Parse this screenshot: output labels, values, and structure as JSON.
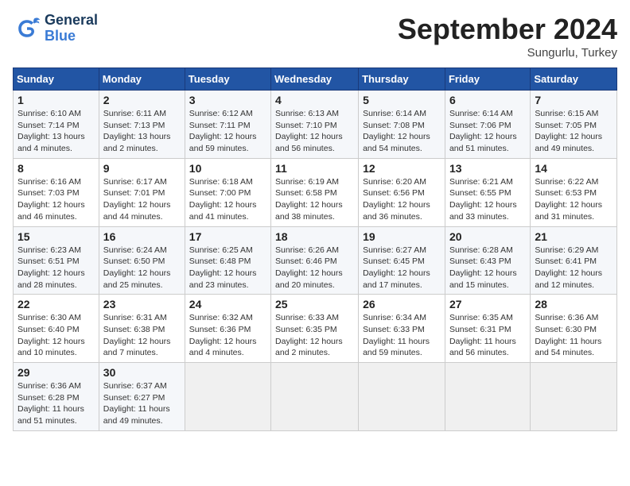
{
  "header": {
    "logo_general": "General",
    "logo_blue": "Blue",
    "month_title": "September 2024",
    "subtitle": "Sungurlu, Turkey"
  },
  "weekdays": [
    "Sunday",
    "Monday",
    "Tuesday",
    "Wednesday",
    "Thursday",
    "Friday",
    "Saturday"
  ],
  "weeks": [
    [
      {
        "day": "1",
        "info": "Sunrise: 6:10 AM\nSunset: 7:14 PM\nDaylight: 13 hours and 4 minutes."
      },
      {
        "day": "2",
        "info": "Sunrise: 6:11 AM\nSunset: 7:13 PM\nDaylight: 13 hours and 2 minutes."
      },
      {
        "day": "3",
        "info": "Sunrise: 6:12 AM\nSunset: 7:11 PM\nDaylight: 12 hours and 59 minutes."
      },
      {
        "day": "4",
        "info": "Sunrise: 6:13 AM\nSunset: 7:10 PM\nDaylight: 12 hours and 56 minutes."
      },
      {
        "day": "5",
        "info": "Sunrise: 6:14 AM\nSunset: 7:08 PM\nDaylight: 12 hours and 54 minutes."
      },
      {
        "day": "6",
        "info": "Sunrise: 6:14 AM\nSunset: 7:06 PM\nDaylight: 12 hours and 51 minutes."
      },
      {
        "day": "7",
        "info": "Sunrise: 6:15 AM\nSunset: 7:05 PM\nDaylight: 12 hours and 49 minutes."
      }
    ],
    [
      {
        "day": "8",
        "info": "Sunrise: 6:16 AM\nSunset: 7:03 PM\nDaylight: 12 hours and 46 minutes."
      },
      {
        "day": "9",
        "info": "Sunrise: 6:17 AM\nSunset: 7:01 PM\nDaylight: 12 hours and 44 minutes."
      },
      {
        "day": "10",
        "info": "Sunrise: 6:18 AM\nSunset: 7:00 PM\nDaylight: 12 hours and 41 minutes."
      },
      {
        "day": "11",
        "info": "Sunrise: 6:19 AM\nSunset: 6:58 PM\nDaylight: 12 hours and 38 minutes."
      },
      {
        "day": "12",
        "info": "Sunrise: 6:20 AM\nSunset: 6:56 PM\nDaylight: 12 hours and 36 minutes."
      },
      {
        "day": "13",
        "info": "Sunrise: 6:21 AM\nSunset: 6:55 PM\nDaylight: 12 hours and 33 minutes."
      },
      {
        "day": "14",
        "info": "Sunrise: 6:22 AM\nSunset: 6:53 PM\nDaylight: 12 hours and 31 minutes."
      }
    ],
    [
      {
        "day": "15",
        "info": "Sunrise: 6:23 AM\nSunset: 6:51 PM\nDaylight: 12 hours and 28 minutes."
      },
      {
        "day": "16",
        "info": "Sunrise: 6:24 AM\nSunset: 6:50 PM\nDaylight: 12 hours and 25 minutes."
      },
      {
        "day": "17",
        "info": "Sunrise: 6:25 AM\nSunset: 6:48 PM\nDaylight: 12 hours and 23 minutes."
      },
      {
        "day": "18",
        "info": "Sunrise: 6:26 AM\nSunset: 6:46 PM\nDaylight: 12 hours and 20 minutes."
      },
      {
        "day": "19",
        "info": "Sunrise: 6:27 AM\nSunset: 6:45 PM\nDaylight: 12 hours and 17 minutes."
      },
      {
        "day": "20",
        "info": "Sunrise: 6:28 AM\nSunset: 6:43 PM\nDaylight: 12 hours and 15 minutes."
      },
      {
        "day": "21",
        "info": "Sunrise: 6:29 AM\nSunset: 6:41 PM\nDaylight: 12 hours and 12 minutes."
      }
    ],
    [
      {
        "day": "22",
        "info": "Sunrise: 6:30 AM\nSunset: 6:40 PM\nDaylight: 12 hours and 10 minutes."
      },
      {
        "day": "23",
        "info": "Sunrise: 6:31 AM\nSunset: 6:38 PM\nDaylight: 12 hours and 7 minutes."
      },
      {
        "day": "24",
        "info": "Sunrise: 6:32 AM\nSunset: 6:36 PM\nDaylight: 12 hours and 4 minutes."
      },
      {
        "day": "25",
        "info": "Sunrise: 6:33 AM\nSunset: 6:35 PM\nDaylight: 12 hours and 2 minutes."
      },
      {
        "day": "26",
        "info": "Sunrise: 6:34 AM\nSunset: 6:33 PM\nDaylight: 11 hours and 59 minutes."
      },
      {
        "day": "27",
        "info": "Sunrise: 6:35 AM\nSunset: 6:31 PM\nDaylight: 11 hours and 56 minutes."
      },
      {
        "day": "28",
        "info": "Sunrise: 6:36 AM\nSunset: 6:30 PM\nDaylight: 11 hours and 54 minutes."
      }
    ],
    [
      {
        "day": "29",
        "info": "Sunrise: 6:36 AM\nSunset: 6:28 PM\nDaylight: 11 hours and 51 minutes."
      },
      {
        "day": "30",
        "info": "Sunrise: 6:37 AM\nSunset: 6:27 PM\nDaylight: 11 hours and 49 minutes."
      },
      {
        "day": "",
        "info": ""
      },
      {
        "day": "",
        "info": ""
      },
      {
        "day": "",
        "info": ""
      },
      {
        "day": "",
        "info": ""
      },
      {
        "day": "",
        "info": ""
      }
    ]
  ]
}
